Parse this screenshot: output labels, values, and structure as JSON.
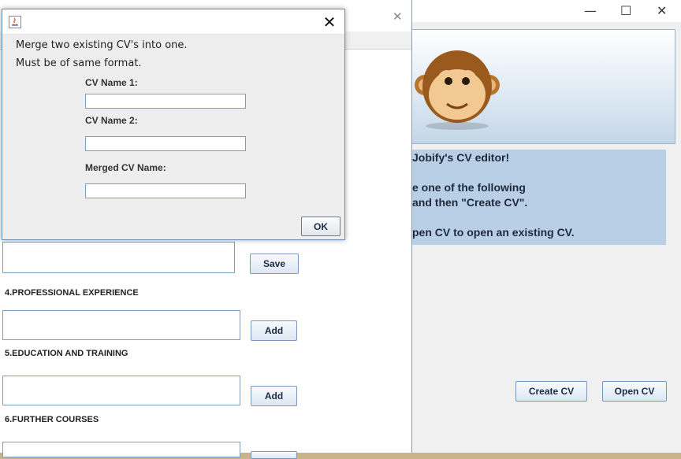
{
  "main_window": {
    "title": "",
    "controls": {
      "minimize": "—",
      "maximize": "☐",
      "close": "✕"
    },
    "info_lines": [
      "Jobify's CV editor!",
      "e one of the following",
      "and then \"Create CV\".",
      "pen CV to open an existing CV."
    ],
    "create_cv_label": "Create CV",
    "open_cv_label": "Open CV"
  },
  "editor_window": {
    "close": "✕",
    "save_label": "Save",
    "sections": [
      {
        "label": "4.PROFESSIONAL EXPERIENCE",
        "button": "Add"
      },
      {
        "label": "5.EDUCATION AND TRAINING",
        "button": "Add"
      },
      {
        "label": "6.FURTHER COURSES",
        "button": ""
      }
    ]
  },
  "dialog": {
    "close": "✕",
    "message_line1": "Merge two existing CV's into one.",
    "message_line2": "Must be of same format.",
    "cv_name1_label": "CV Name 1:",
    "cv_name1_value": "",
    "cv_name2_label": "CV Name 2:",
    "cv_name2_value": "",
    "merged_label": "Merged CV Name:",
    "merged_value": "",
    "ok_label": "OK"
  },
  "colors": {
    "accent": "#b8cfe6",
    "border": "#7f9db9"
  }
}
